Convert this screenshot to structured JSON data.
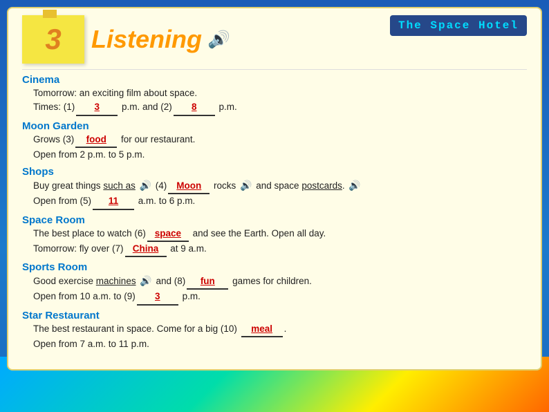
{
  "header": {
    "number": "3",
    "title": "Listening",
    "hotel_title": "The Space Hotel"
  },
  "sections": [
    {
      "id": "cinema",
      "title": "Cinema",
      "lines": [
        "Tomorrow: an exciting film about space.",
        "Times: (1)_______  p.m. and (2)_______  p.m."
      ],
      "answers": {
        "1": "3",
        "2": "8"
      }
    },
    {
      "id": "moon-garden",
      "title": "Moon Garden",
      "lines": [
        "Grows (3)_______ for our restaurant.",
        "Open from 2 p.m. to 5 p.m."
      ],
      "answers": {
        "3": "food"
      }
    },
    {
      "id": "shops",
      "title": "Shops",
      "lines": [
        "Buy great things such as  (4)_______ rocks  and space postcards.",
        "Open from (5)_______ a.m. to 6 p.m."
      ],
      "answers": {
        "4": "Moon",
        "5": "11"
      }
    },
    {
      "id": "space-room",
      "title": "Space Room",
      "lines": [
        "The best place to watch (6)_______ and see the Earth. Open all day.",
        "Tomorrow: fly over (7)_______ at 9 a.m."
      ],
      "answers": {
        "6": "space",
        "7": "China"
      }
    },
    {
      "id": "sports-room",
      "title": "Sports Room",
      "lines": [
        "Good exercise machines  and (8)_______ games for children.",
        "Open from 10 a.m. to (9)_______ p.m."
      ],
      "answers": {
        "8": "fun",
        "9": "3"
      }
    },
    {
      "id": "star-restaurant",
      "title": "Star Restaurant",
      "lines": [
        "The best restaurant in space. Come for a big (10) _______.",
        "Open from 7 a.m. to 11 p.m."
      ],
      "answers": {
        "10": "meal"
      }
    }
  ]
}
